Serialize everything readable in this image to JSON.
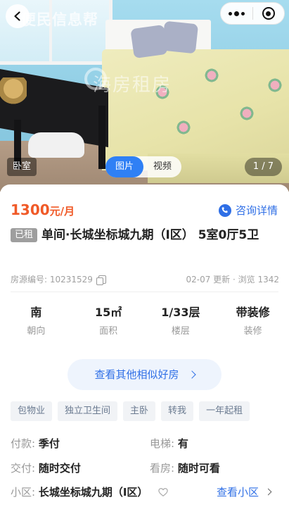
{
  "header": {
    "app_title": "便民信息帮",
    "watermark": "海房租房",
    "room_label": "卧室",
    "media_tabs": [
      {
        "label": "图片",
        "active": true
      },
      {
        "label": "视频",
        "active": false
      }
    ],
    "photo_counter": "1 / 7"
  },
  "listing": {
    "price_value": "1300",
    "price_unit": "元/月",
    "consult_label": "咨询详情",
    "status_badge": "已租",
    "title": "单间·长城坐标城九期（I区） 5室0厅5卫",
    "listing_id_label": "房源编号: 10231529",
    "updated": "02-07 更新",
    "views": "浏览 1342",
    "facts": [
      {
        "value": "南",
        "key": "朝向"
      },
      {
        "value": "15㎡",
        "key": "面积"
      },
      {
        "value": "1/33层",
        "key": "楼层"
      },
      {
        "value": "带装修",
        "key": "装修"
      }
    ],
    "similar_button": "查看其他相似好房",
    "tags": [
      "包物业",
      "独立卫生间",
      "主卧",
      "转我",
      "一年起租"
    ],
    "details": {
      "payment_label": "付款:",
      "payment_value": "季付",
      "elevator_label": "电梯:",
      "elevator_value": "有",
      "delivery_label": "交付:",
      "delivery_value": "随时交付",
      "viewing_label": "看房:",
      "viewing_value": "随时可看"
    },
    "community": {
      "label": "小区:",
      "value": "长城坐标城九期（I区）",
      "link": "查看小区"
    }
  },
  "colors": {
    "accent": "#2f6fe6",
    "price": "#f05a28",
    "badge": "#9e9e9e"
  }
}
